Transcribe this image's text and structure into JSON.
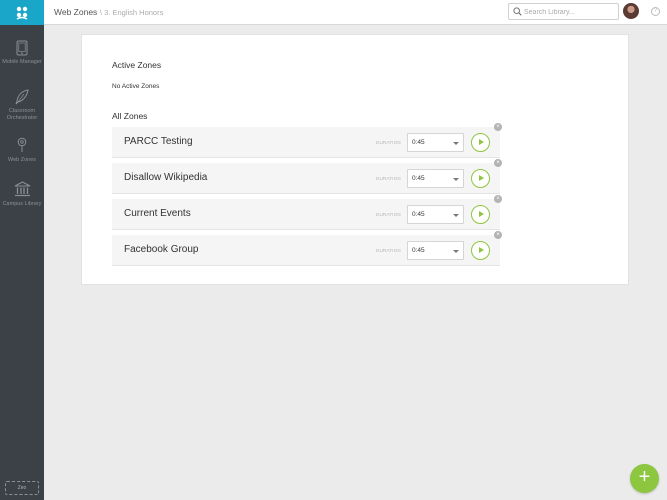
{
  "header": {
    "title": "Web Zones",
    "separator": "\\",
    "subtitle": "3. English Honors",
    "search_placeholder": "Search Library...",
    "help_label": "?"
  },
  "sidebar": {
    "items": [
      {
        "label": "Mobile Manager",
        "icon": "tablet-icon"
      },
      {
        "label": "Classroom Orchestrator",
        "icon": "quill-icon"
      },
      {
        "label": "Web Zones",
        "icon": "location-pin-icon"
      },
      {
        "label": "Campus Library",
        "icon": "library-building-icon"
      }
    ],
    "footer_badge": "Zeo"
  },
  "main": {
    "active_zones_title": "Active Zones",
    "no_active_text": "No Active Zones",
    "all_zones_title": "All Zones",
    "duration_label": "DURATION",
    "zones": [
      {
        "name": "PARCC Testing",
        "duration": "0:45"
      },
      {
        "name": "Disallow Wikipedia",
        "duration": "0:45"
      },
      {
        "name": "Current Events",
        "duration": "0:45"
      },
      {
        "name": "Facebook Group",
        "duration": "0:45"
      }
    ]
  },
  "fab": {
    "label": "+"
  },
  "colors": {
    "brand": "#1aa6c9",
    "sidebar": "#3b4146",
    "accent_green": "#8dc63f"
  }
}
